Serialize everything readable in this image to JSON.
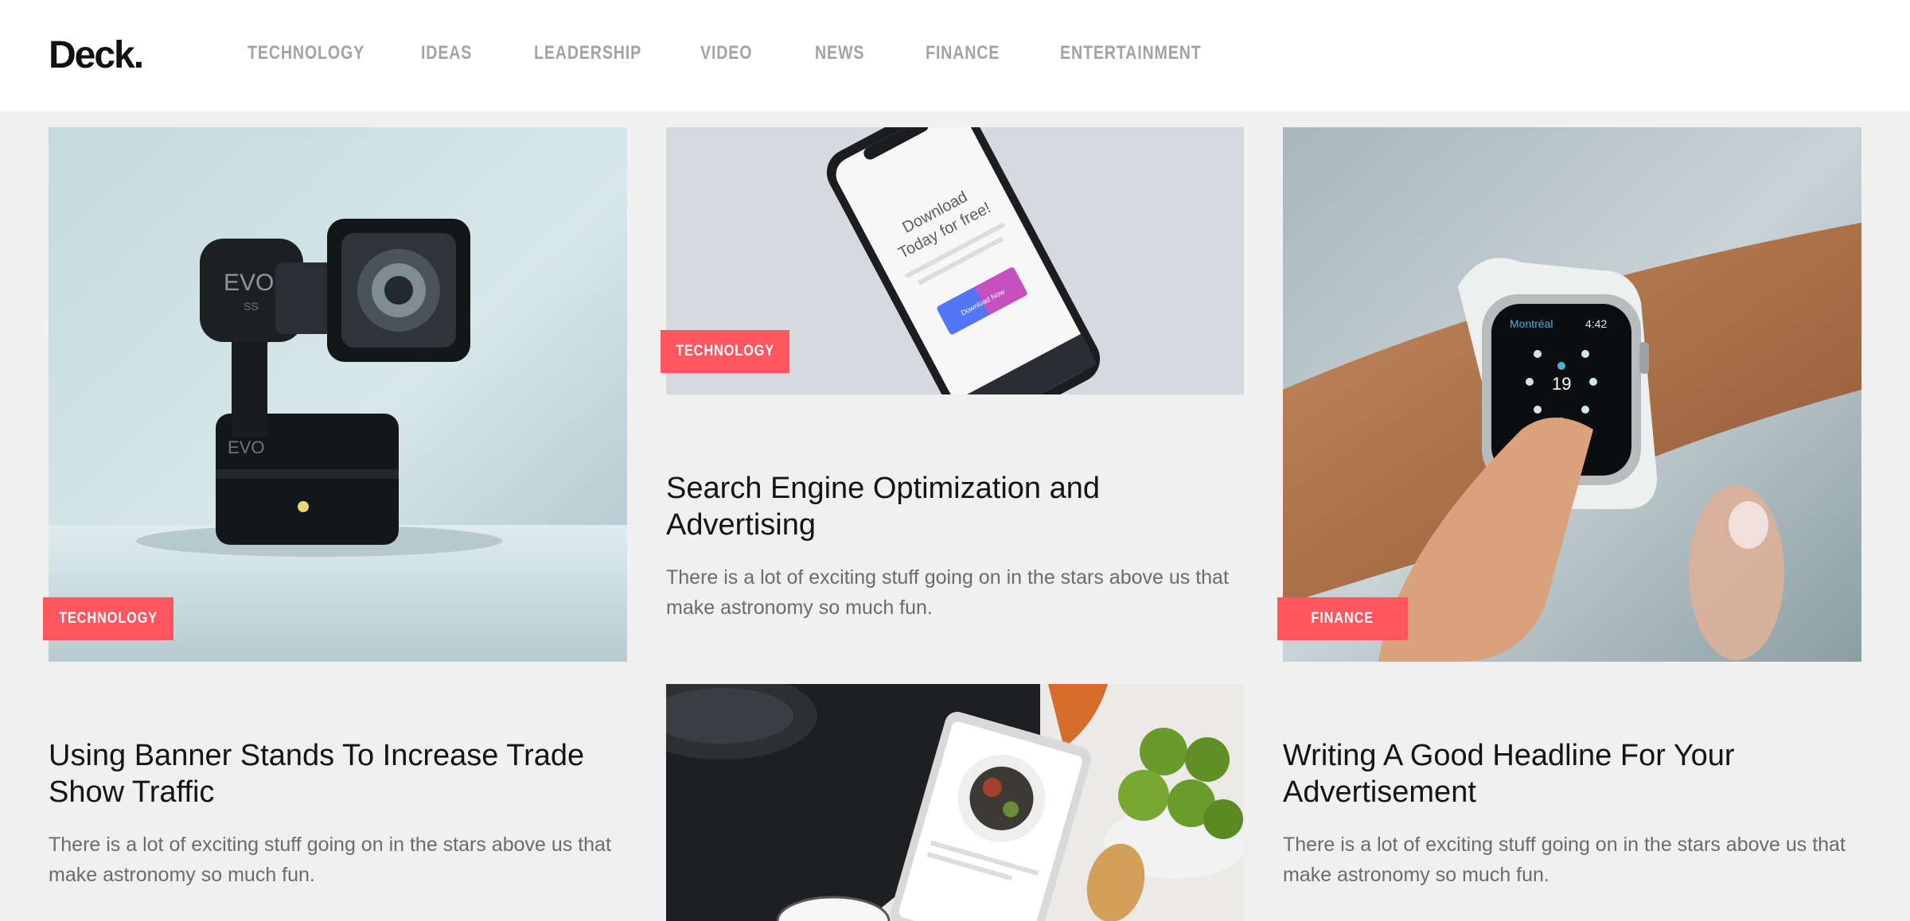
{
  "header": {
    "logo": "Deck.",
    "nav": [
      {
        "label": "TECHNOLOGY"
      },
      {
        "label": "IDEAS"
      },
      {
        "label": "LEADERSHIP"
      },
      {
        "label": "VIDEO"
      },
      {
        "label": "NEWS"
      },
      {
        "label": "FINANCE"
      },
      {
        "label": "ENTERTAINMENT"
      }
    ]
  },
  "colors": {
    "accent": "#ff555e",
    "background": "#f0f0f0",
    "nav_text": "#a3a3a3"
  },
  "posts": [
    {
      "image": "gimbal-camera-photo",
      "category": "TECHNOLOGY",
      "title": "Using Banner Stands To Increase Trade Show Traffic",
      "excerpt": "There is a lot of exciting stuff going on in the stars above us that make astronomy so much fun."
    },
    {
      "image": "smartphone-download-photo",
      "category": "TECHNOLOGY",
      "title": "Search Engine Optimization and Advertising",
      "excerpt": "There is a lot of exciting stuff going on in the stars above us that make astronomy so much fun."
    },
    {
      "image": "smartwatch-wrist-photo",
      "category": "FINANCE",
      "title": "Writing A Good Headline For Your Advertisement",
      "excerpt": "There is a lot of exciting stuff going on in the stars above us that make astronomy so much fun."
    },
    {
      "image": "tablet-kitchen-photo"
    }
  ],
  "photo_text": {
    "gimbal_brand": "EVO",
    "gimbal_model": "SS",
    "phone_headline_1": "Download",
    "phone_headline_2": "Today for free!",
    "phone_button": "Download Now",
    "watch_city": "Montréal",
    "watch_time": "4:42",
    "watch_day": "19"
  }
}
